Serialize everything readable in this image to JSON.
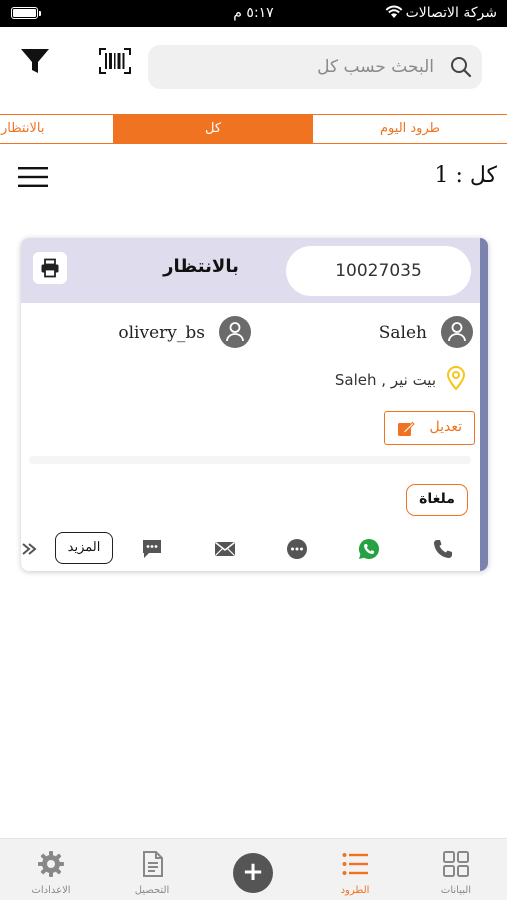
{
  "status_bar": {
    "carrier": "شركة الاتصالات",
    "time": "٥:١٧ م",
    "battery_level": 1.0
  },
  "search": {
    "placeholder": "البحث حسب كل",
    "value": ""
  },
  "icons": {
    "filter": "filter-icon",
    "barcode": "barcode-scanner-icon",
    "search": "search-icon",
    "menu": "hamburger-menu-icon"
  },
  "tabs": [
    {
      "label": "طرود اليوم",
      "active": false
    },
    {
      "label": "كل",
      "active": true
    },
    {
      "label": "بالانتظار",
      "active": false
    }
  ],
  "count_label": "كل : 1",
  "card": {
    "order_number": "10027035",
    "status": "بالانتظار",
    "receiver_name": "Saleh",
    "sender_name": "olivery_bs",
    "address": "بيت نير , Saleh",
    "edit_label": "تعديل",
    "cancelled_label": "ملغاة",
    "more_label": "المزيد",
    "status_color": "#7b82ad",
    "header_color": "#dedced"
  },
  "bottom_nav": [
    {
      "label": "البيانات",
      "icon": "grid-icon",
      "active": false
    },
    {
      "label": "الطرود",
      "icon": "list-icon",
      "active": true
    },
    {
      "label": "",
      "icon": "add-icon",
      "active": false
    },
    {
      "label": "التحصيل",
      "icon": "document-icon",
      "active": false
    },
    {
      "label": "الاعدادات",
      "icon": "gear-icon",
      "active": false
    }
  ],
  "colors": {
    "accent": "#f07322",
    "whatsapp": "#25a244"
  }
}
